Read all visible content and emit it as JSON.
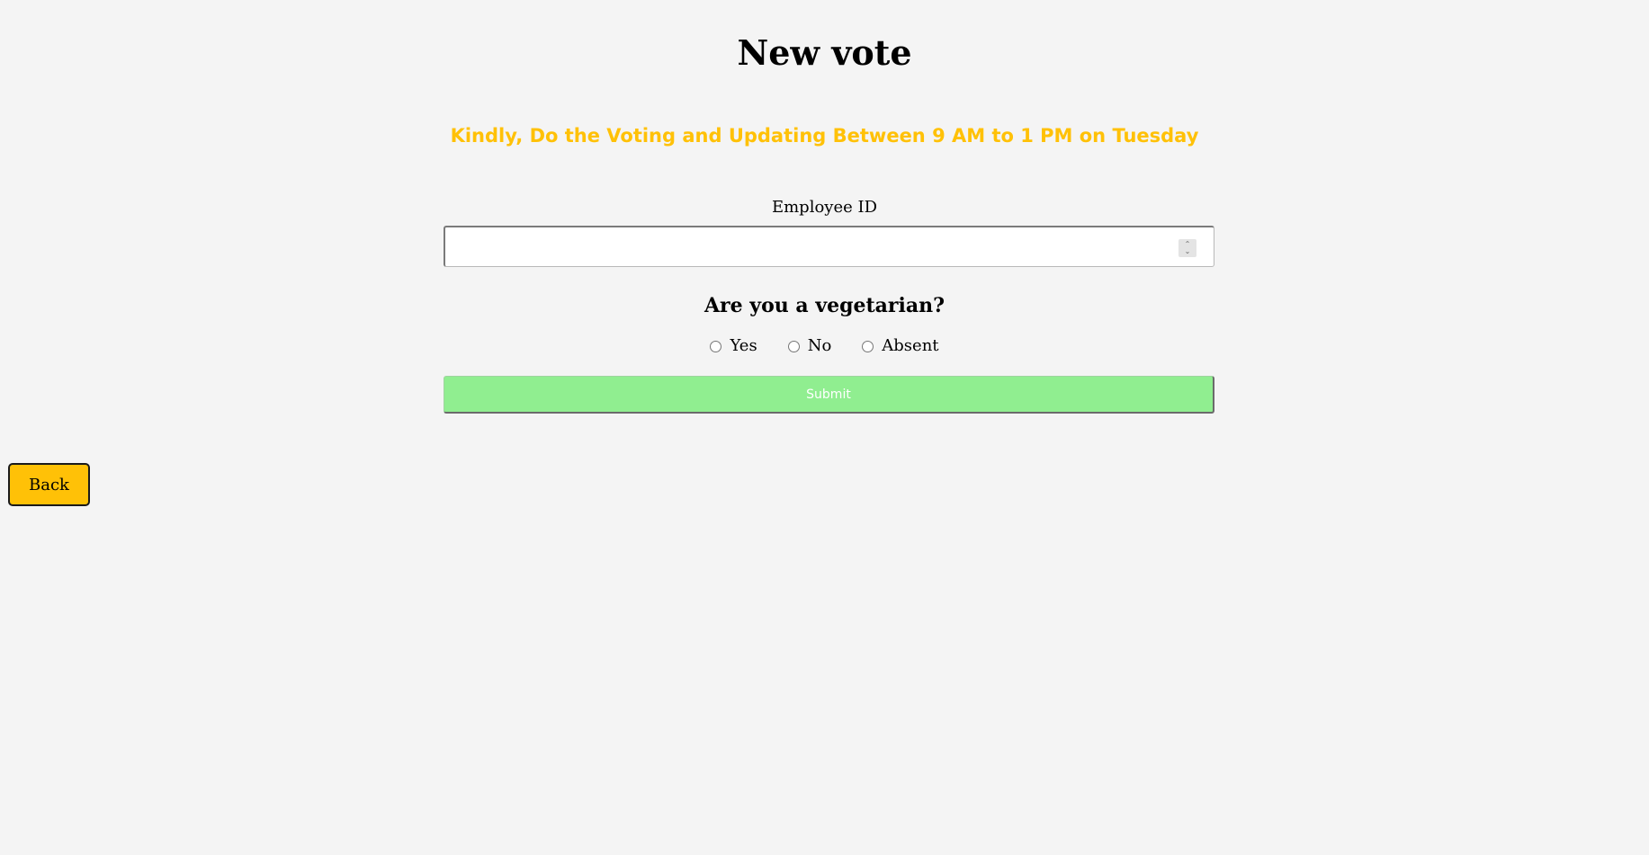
{
  "page": {
    "title": "New vote",
    "notice": "Kindly, Do the Voting and Updating Between 9 AM to 1 PM on Tuesday"
  },
  "form": {
    "employee_id_label": "Employee ID",
    "employee_id_value": "",
    "employee_id_placeholder": "",
    "question": "Are you a vegetarian?",
    "options": [
      "Yes",
      "No",
      "Absent"
    ],
    "selected_option": null,
    "submit_label": "Submit"
  },
  "navigation": {
    "back_label": "Back"
  },
  "colors": {
    "background": "#f4f4f4",
    "notice": "#ffc107",
    "submit_background": "#90ee90",
    "back_background": "#ffc107"
  }
}
